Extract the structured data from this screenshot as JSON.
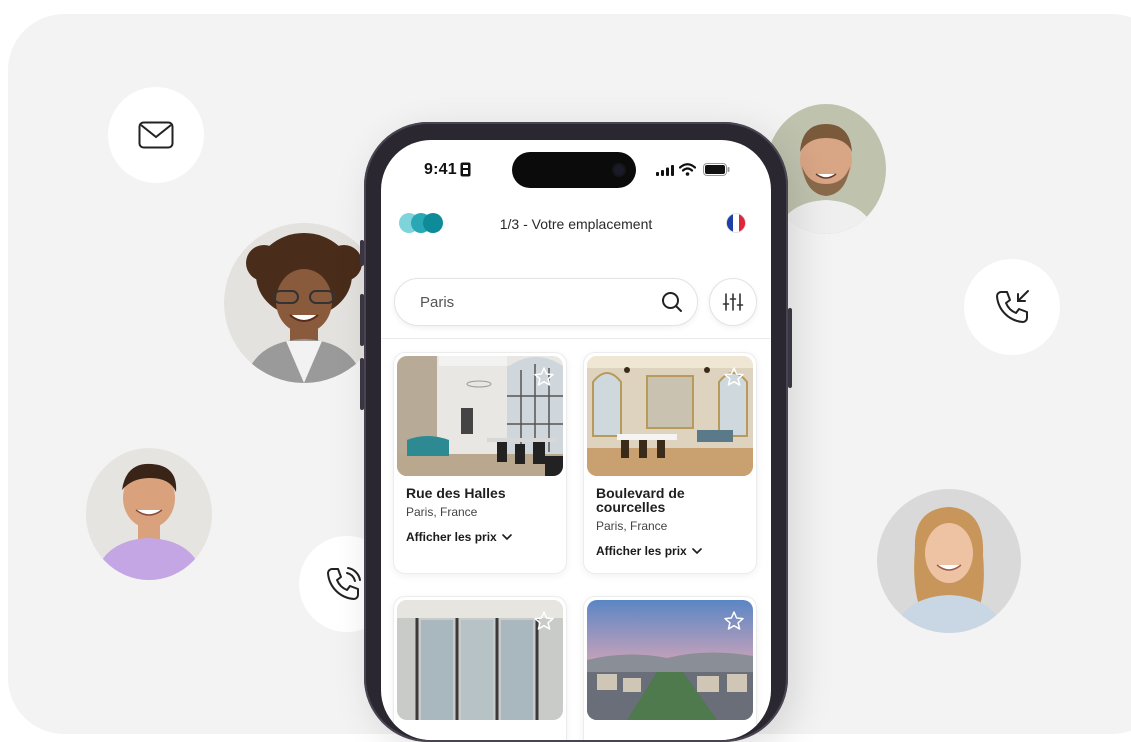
{
  "status": {
    "time": "9:41"
  },
  "header": {
    "title": "1/3 - Votre emplacement"
  },
  "search": {
    "value": "Paris"
  },
  "listings": [
    {
      "title": "Rue des Halles",
      "location": "Paris, France",
      "price_label": "Afficher les prix"
    },
    {
      "title": "Boulevard de courcelles",
      "location": "Paris, France",
      "price_label": "Afficher les prix"
    }
  ],
  "colors": {
    "brand_teal": "#0e8b99",
    "brand_light": "#7fd4dc",
    "backdrop": "#f3f3f3"
  },
  "icons": [
    "mail-icon",
    "phone-incoming-icon",
    "phone-ringing-icon",
    "search-icon",
    "filter-sliders-icon",
    "star-outline-icon",
    "chevron-down-icon",
    "france-flag-icon"
  ]
}
